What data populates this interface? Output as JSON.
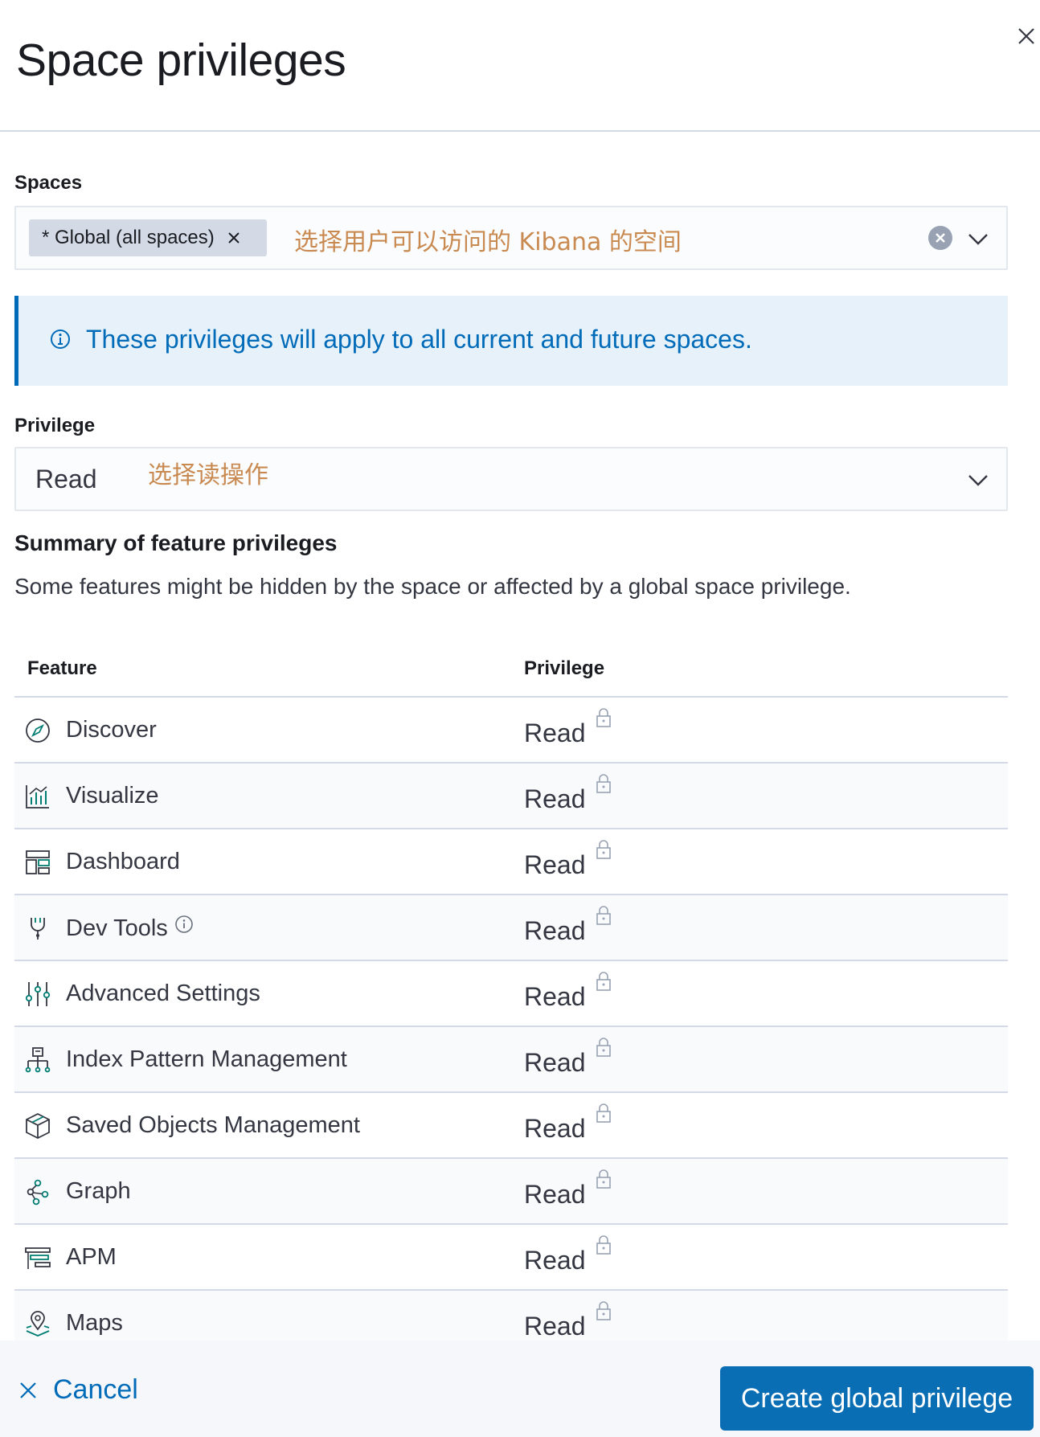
{
  "flyout": {
    "title": "Space privileges",
    "close_icon": "close-icon"
  },
  "spaces": {
    "label": "Spaces",
    "selected_chip": "* Global (all spaces)",
    "annotation": "选择用户可以访问的 Kibana 的空间"
  },
  "callout": {
    "icon": "info-icon",
    "text": "These privileges will apply to all current and future spaces."
  },
  "privilege": {
    "label": "Privilege",
    "value": "Read",
    "annotation": "选择读操作"
  },
  "summary": {
    "title": "Summary of feature privileges",
    "description": "Some features might be hidden by the space or affected by a global space privilege."
  },
  "table": {
    "headers": [
      "Feature",
      "Privilege"
    ],
    "rows": [
      {
        "feature": "Discover",
        "privilege": "Read",
        "icon": "discover-icon"
      },
      {
        "feature": "Visualize",
        "privilege": "Read",
        "icon": "visualize-icon"
      },
      {
        "feature": "Dashboard",
        "privilege": "Read",
        "icon": "dashboard-icon"
      },
      {
        "feature": "Dev Tools",
        "privilege": "Read",
        "icon": "dev-tools-icon"
      },
      {
        "feature": "Advanced Settings",
        "privilege": "Read",
        "icon": "advanced-settings-icon"
      },
      {
        "feature": "Index Pattern Management",
        "privilege": "Read",
        "icon": "index-pattern-icon"
      },
      {
        "feature": "Saved Objects Management",
        "privilege": "Read",
        "icon": "saved-objects-icon"
      },
      {
        "feature": "Graph",
        "privilege": "Read",
        "icon": "graph-icon"
      },
      {
        "feature": "APM",
        "privilege": "Read",
        "icon": "apm-icon"
      },
      {
        "feature": "Maps",
        "privilege": "Read",
        "icon": "maps-icon"
      }
    ]
  },
  "footer": {
    "cancel_label": "Cancel",
    "create_label": "Create global privilege"
  },
  "colors": {
    "accent": "#006bb8",
    "primary_button": "#0a6eb4",
    "annotation": "#c98a52",
    "callout_bg": "#e6f1fa"
  }
}
